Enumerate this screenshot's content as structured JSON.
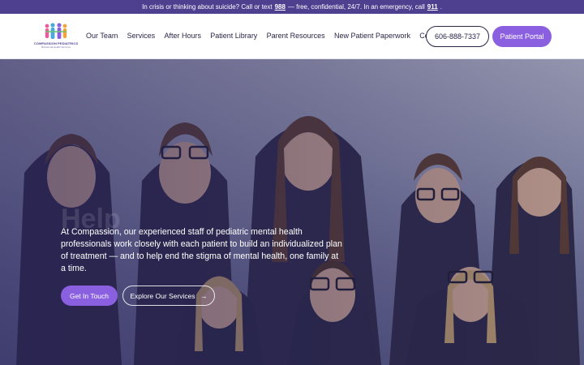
{
  "crisis_bar": {
    "prefix": "In crisis or thinking about suicide? Call or text",
    "crisis_number": "988",
    "middle": "— free, confidential, 24/7. In an emergency, call",
    "emergency_number": "911",
    "suffix": "."
  },
  "logo": {
    "name": "COMPASSION PEDIATRICS",
    "subtitle": "Behavioral Health Services"
  },
  "nav": {
    "items": [
      "Our Team",
      "Services",
      "After Hours",
      "Patient Library",
      "Parent Resources",
      "New Patient Paperwork",
      "Contact"
    ]
  },
  "header": {
    "phone_label": "606-888-7337",
    "portal_label": "Patient Portal"
  },
  "hero": {
    "ghost_heading": "Help",
    "description": "At Compassion, our experienced staff of pediatric mental health professionals work closely with each patient to build an individualized plan of treatment — and to help end the stigma of mental health, one family at a time.",
    "primary_button": "Get In Touch",
    "secondary_button": "Explore Our Services",
    "secondary_arrow": "→"
  },
  "colors": {
    "brand_purple": "#4e3f8f",
    "accent_purple": "#8a5fe0",
    "text_dark": "#2b2546"
  }
}
